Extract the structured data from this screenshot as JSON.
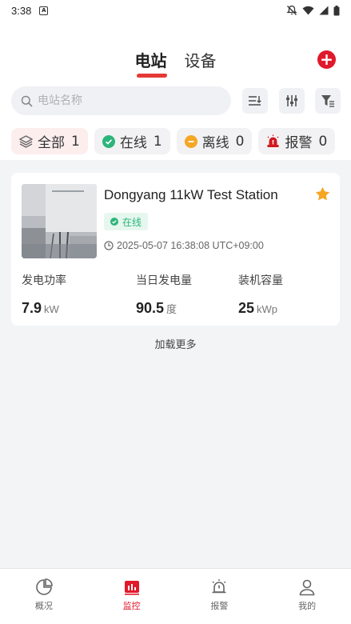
{
  "status_bar": {
    "time": "3:38"
  },
  "tabs": [
    {
      "label": "电站",
      "active": true
    },
    {
      "label": "设备",
      "active": false
    }
  ],
  "search": {
    "placeholder": "电站名称"
  },
  "filters": [
    {
      "label": "全部",
      "count": "1",
      "icon": "layers-icon"
    },
    {
      "label": "在线",
      "count": "1",
      "icon": "check-circle-icon"
    },
    {
      "label": "离线",
      "count": "0",
      "icon": "minus-circle-icon"
    },
    {
      "label": "报警",
      "count": "0",
      "icon": "alarm-siren-icon"
    }
  ],
  "station": {
    "name": "Dongyang 11kW Test Station",
    "status": "在线",
    "timestamp": "2025-05-07 16:38:08 UTC+09:00",
    "favorite": true,
    "metrics": [
      {
        "label": "发电功率",
        "value": "7.9",
        "unit": "kW"
      },
      {
        "label": "当日发电量",
        "value": "90.5",
        "unit": "度"
      },
      {
        "label": "装机容量",
        "value": "25",
        "unit": "kWp"
      }
    ]
  },
  "load_more": "加载更多",
  "nav": [
    {
      "label": "概况",
      "active": false
    },
    {
      "label": "监控",
      "active": true
    },
    {
      "label": "报警",
      "active": false
    },
    {
      "label": "我的",
      "active": false
    }
  ],
  "colors": {
    "accent": "#e0192b",
    "online": "#2cb57a",
    "offline": "#f5a623",
    "star": "#f5a623"
  }
}
